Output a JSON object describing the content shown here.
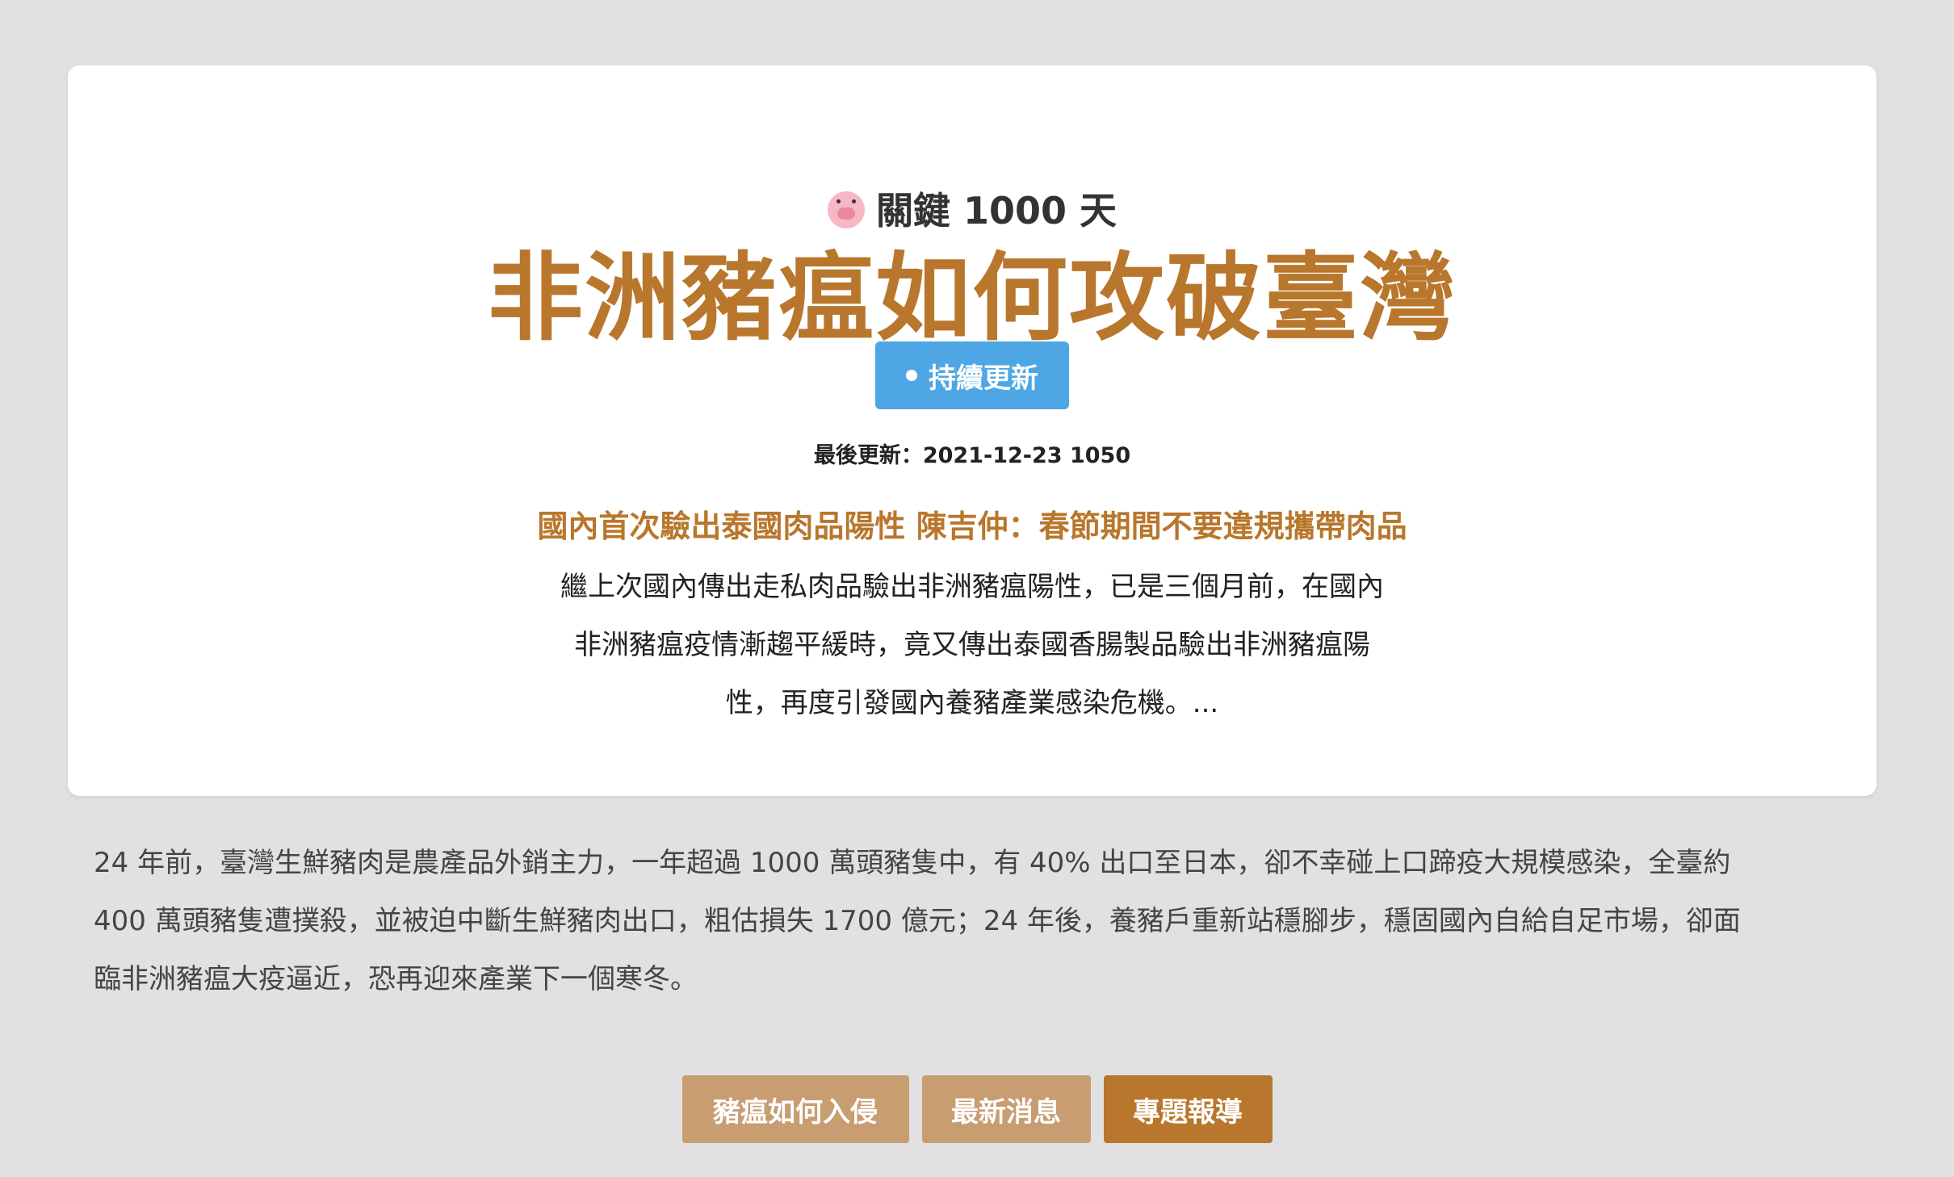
{
  "header": {
    "kicker_icon": "pig-face-icon",
    "kicker": "關鍵 1000 天",
    "title": "非洲豬瘟如何攻破臺灣",
    "badge_label": "持續更新",
    "updated": "最後更新：2021-12-23 1050"
  },
  "latest_news": {
    "headline": "國內首次驗出泰國肉品陽性 陳吉仲：春節期間不要違規攜帶肉品",
    "summary_lines": [
      "繼上次國內傳出走私肉品驗出非洲豬瘟陽性，已是三個月前，在國內",
      "非洲豬瘟疫情漸趨平緩時，竟又傳出泰國香腸製品驗出非洲豬瘟陽",
      "性，再度引發國內養豬產業感染危機。..."
    ]
  },
  "intro": {
    "lines": [
      "24 年前，臺灣生鮮豬肉是農產品外銷主力，一年超過 1000 萬頭豬隻中，有 40% 出口至日本，卻不幸碰上口蹄疫大規模感染，全臺約",
      "400 萬頭豬隻遭撲殺，並被迫中斷生鮮豬肉出口，粗估損失 1700 億元；24 年後，養豬戶重新站穩腳步，穩固國內自給自足市場，卻面",
      "臨非洲豬瘟大疫逼近，恐再迎來產業下一個寒冬。"
    ]
  },
  "nav": {
    "items": [
      {
        "label": "豬瘟如何入侵"
      },
      {
        "label": "最新消息"
      },
      {
        "label": "專題報導"
      }
    ]
  },
  "colors": {
    "accent": "#b8772c",
    "accent_light": "#c89d72",
    "badge": "#4ea7e4",
    "background": "#e1e1e1"
  }
}
